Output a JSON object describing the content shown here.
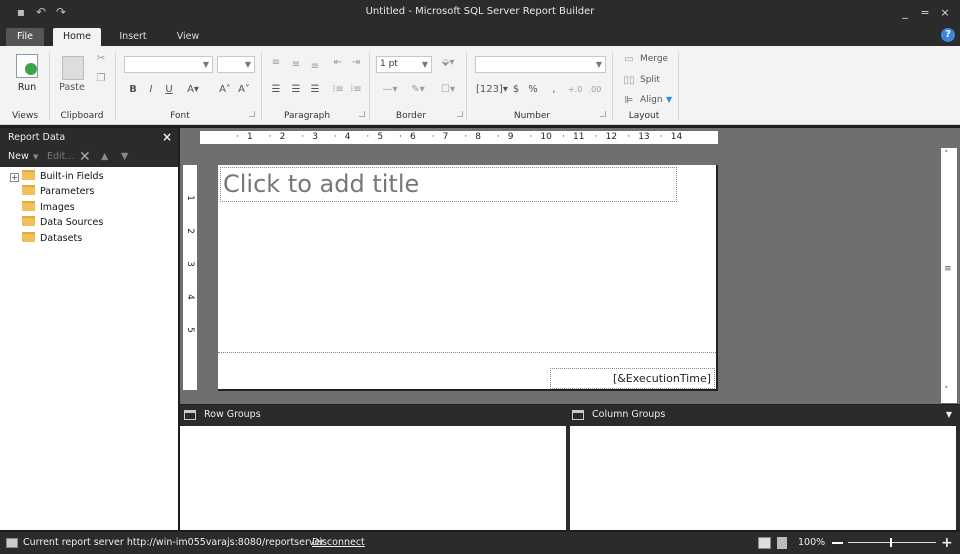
{
  "window": {
    "title": "Untitled - Microsoft SQL Server Report Builder"
  },
  "tabs": [
    "File",
    "Home",
    "Insert",
    "View"
  ],
  "ribbon": {
    "views": {
      "run_label": "Run",
      "group": "Views"
    },
    "clipboard": {
      "paste_label": "Paste",
      "group": "Clipboard"
    },
    "font": {
      "group": "Font"
    },
    "paragraph": {
      "group": "Paragraph"
    },
    "border": {
      "width_value": "1 pt",
      "group": "Border"
    },
    "number": {
      "group": "Number"
    },
    "layout": {
      "merge": "Merge",
      "split": "Split",
      "align": "Align",
      "group": "Layout"
    }
  },
  "report_data": {
    "title": "Report Data",
    "new_label": "New",
    "edit_label": "Edit...",
    "items": [
      "Built-in Fields",
      "Parameters",
      "Images",
      "Data Sources",
      "Datasets"
    ]
  },
  "ruler": {
    "h": [
      "1",
      "2",
      "3",
      "4",
      "5",
      "6",
      "7",
      "8",
      "9",
      "10",
      "11",
      "12",
      "13",
      "14"
    ],
    "v": [
      "1",
      "2",
      "3",
      "4",
      "5"
    ]
  },
  "report": {
    "title_placeholder": "Click to add title",
    "execution_time": "[&ExecutionTime]"
  },
  "groups": {
    "row": "Row Groups",
    "column": "Column Groups"
  },
  "status": {
    "server_text": "Current report server http://win-im055varajs:8080/reportserver",
    "disconnect": "Disconnect",
    "zoom": "100%"
  }
}
